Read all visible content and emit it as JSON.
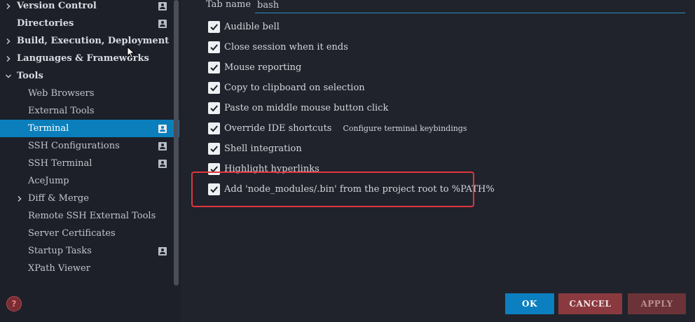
{
  "sidebar": {
    "items": [
      {
        "label": "Version Control",
        "level": 0,
        "expandable": true,
        "expanded": false,
        "project_icon": true
      },
      {
        "label": "Directories",
        "level": 0,
        "expandable": false,
        "expanded": false,
        "project_icon": true
      },
      {
        "label": "Build, Execution, Deployment",
        "level": 0,
        "expandable": true,
        "expanded": false,
        "project_icon": false
      },
      {
        "label": "Languages & Frameworks",
        "level": 0,
        "expandable": true,
        "expanded": false,
        "project_icon": false
      },
      {
        "label": "Tools",
        "level": 0,
        "expandable": true,
        "expanded": true,
        "project_icon": false
      },
      {
        "label": "Web Browsers",
        "level": 1,
        "expandable": false,
        "project_icon": false
      },
      {
        "label": "External Tools",
        "level": 1,
        "expandable": false,
        "project_icon": false
      },
      {
        "label": "Terminal",
        "level": 1,
        "expandable": false,
        "project_icon": true,
        "selected": true
      },
      {
        "label": "SSH Configurations",
        "level": 1,
        "expandable": false,
        "project_icon": true
      },
      {
        "label": "SSH Terminal",
        "level": 1,
        "expandable": false,
        "project_icon": true
      },
      {
        "label": "AceJump",
        "level": 1,
        "expandable": false,
        "project_icon": false
      },
      {
        "label": "Diff & Merge",
        "level": 1,
        "expandable": true,
        "expanded": false,
        "project_icon": false
      },
      {
        "label": "Remote SSH External Tools",
        "level": 1,
        "expandable": false,
        "project_icon": false
      },
      {
        "label": "Server Certificates",
        "level": 1,
        "expandable": false,
        "project_icon": false
      },
      {
        "label": "Startup Tasks",
        "level": 1,
        "expandable": false,
        "project_icon": true
      },
      {
        "label": "XPath Viewer",
        "level": 1,
        "expandable": false,
        "project_icon": false
      }
    ],
    "help_icon": "question-circle-icon"
  },
  "main": {
    "tab_name_label": "Tab name",
    "tab_name_value": "bash",
    "options": [
      {
        "label": "Audible bell",
        "checked": true
      },
      {
        "label": "Close session when it ends",
        "checked": true
      },
      {
        "label": "Mouse reporting",
        "checked": true
      },
      {
        "label": "Copy to clipboard on selection",
        "checked": true
      },
      {
        "label": "Paste on middle mouse button click",
        "checked": true
      },
      {
        "label": "Override IDE shortcuts",
        "checked": true
      },
      {
        "label": "Shell integration",
        "checked": true
      },
      {
        "label": "Highlight hyperlinks",
        "checked": true
      },
      {
        "label": "Add 'node_modules/.bin' from the project root to %PATH%",
        "checked": true
      }
    ],
    "configure_keybindings_link": "Configure terminal keybindings"
  },
  "buttons": {
    "ok": "OK",
    "cancel": "CANCEL",
    "apply": "APPLY"
  },
  "colors": {
    "accent": "#0b7fbf",
    "highlight_border": "#e0363d",
    "cancel": "#8a3a3f",
    "apply": "#6b3338"
  }
}
